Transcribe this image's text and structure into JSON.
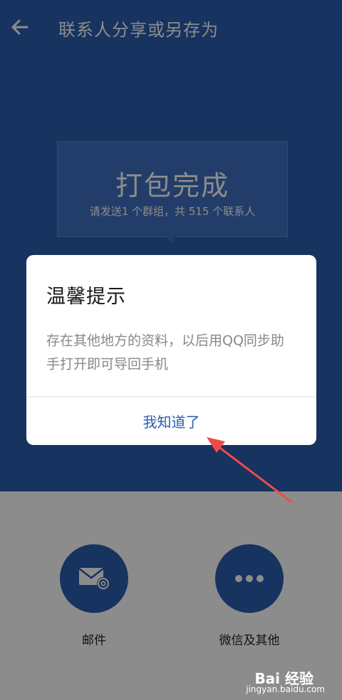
{
  "header": {
    "title": "联系人分享或另存为",
    "back_icon": "arrow-left-icon"
  },
  "summary": {
    "title": "打包完成",
    "subtitle": "请发送1 个群组，共 515 个联系人"
  },
  "share_options": [
    {
      "label": "邮件",
      "icon": "mail-icon"
    },
    {
      "label": "微信及其他",
      "icon": "more-icon"
    }
  ],
  "dialog": {
    "title": "温馨提示",
    "message": "存在其他地方的资料，以后用QQ同步助手打开即可导回手机",
    "button_label": "我知道了"
  },
  "watermark": {
    "brand": "Bai 经验",
    "url": "jingyan.baidu.com"
  },
  "colors": {
    "primary": "#2a5db0",
    "annotation_arrow": "#f04a4a"
  }
}
